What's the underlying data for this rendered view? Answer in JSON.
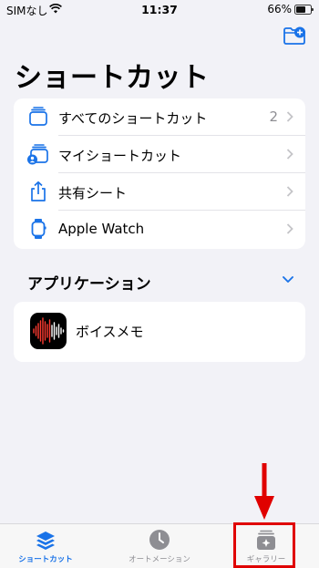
{
  "status_bar": {
    "carrier": "SIMなし",
    "time": "11:37",
    "battery": "66%"
  },
  "header": {
    "title": "ショートカット",
    "folder_icon": "folder-plus-icon"
  },
  "main_list": {
    "items": [
      {
        "label": "すべてのショートカット",
        "count": "2",
        "icon": "stack-icon"
      },
      {
        "label": "マイショートカット",
        "count": "",
        "icon": "person-stack-icon"
      },
      {
        "label": "共有シート",
        "count": "",
        "icon": "share-icon"
      },
      {
        "label": "Apple Watch",
        "count": "",
        "icon": "watch-icon"
      }
    ]
  },
  "apps_section": {
    "title": "アプリケーション",
    "items": [
      {
        "label": "ボイスメモ",
        "icon": "voice-memos-icon"
      }
    ]
  },
  "tabs": [
    {
      "label": "ショートカット",
      "icon": "layers-icon",
      "active": true
    },
    {
      "label": "オートメーション",
      "icon": "clock-check-icon",
      "active": false
    },
    {
      "label": "ギャラリー",
      "icon": "sparkle-stack-icon",
      "active": false
    }
  ],
  "colors": {
    "accent": "#1a73e8",
    "highlight": "#e00000",
    "background": "#f2f2f7"
  }
}
